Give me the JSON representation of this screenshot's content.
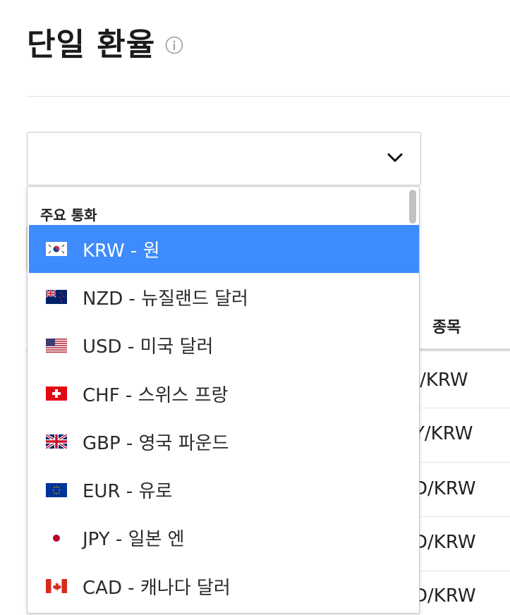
{
  "page": {
    "title": "단일 환율",
    "info_icon": "info-circle-icon"
  },
  "select": {
    "value": "",
    "chevron_icon": "chevron-down-icon",
    "group_label": "주요 통화",
    "options": [
      {
        "label": "KRW - 원",
        "flag": "flag-kr-icon",
        "selected": true
      },
      {
        "label": "NZD - 뉴질랜드 달러",
        "flag": "flag-nz-icon",
        "selected": false
      },
      {
        "label": "USD - 미국 달러",
        "flag": "flag-us-icon",
        "selected": false
      },
      {
        "label": "CHF - 스위스 프랑",
        "flag": "flag-ch-icon",
        "selected": false
      },
      {
        "label": "GBP - 영국 파운드",
        "flag": "flag-gb-icon",
        "selected": false
      },
      {
        "label": "EUR - 유로",
        "flag": "flag-eu-icon",
        "selected": false
      },
      {
        "label": "JPY - 일본 엔",
        "flag": "flag-jp-icon",
        "selected": false
      },
      {
        "label": "CAD - 캐나다 달러",
        "flag": "flag-ca-icon",
        "selected": false
      }
    ]
  },
  "table": {
    "column_header": "종목",
    "rows": [
      "R/KRW",
      "Y/KRW",
      "D/KRW",
      "D/KRW",
      "D/KRW"
    ]
  },
  "colors": {
    "selected_bg": "#3d8bfd",
    "border": "#c6c6c6"
  }
}
